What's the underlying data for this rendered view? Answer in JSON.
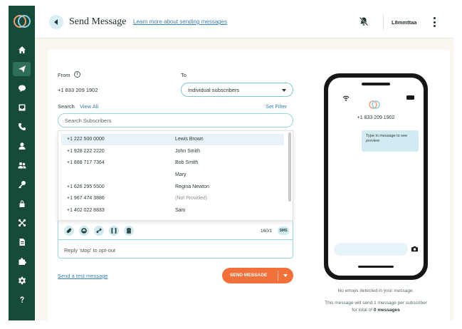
{
  "sidebar": {
    "logo": "logo",
    "items": [
      {
        "icon": "home-icon",
        "active": false
      },
      {
        "icon": "send-icon",
        "active": true
      },
      {
        "icon": "chat-icon",
        "active": false
      },
      {
        "icon": "inbox-icon",
        "active": false
      },
      {
        "icon": "phone-icon",
        "active": false
      },
      {
        "icon": "user-icon",
        "active": false
      },
      {
        "icon": "users-icon",
        "active": false
      },
      {
        "icon": "key-icon",
        "active": false
      },
      {
        "icon": "lock-icon",
        "active": false
      },
      {
        "icon": "integrations-icon",
        "active": false
      },
      {
        "icon": "document-icon",
        "active": false
      },
      {
        "icon": "puzzle-icon",
        "active": false
      },
      {
        "icon": "settings-icon",
        "active": false
      },
      {
        "icon": "help-icon",
        "active": false
      }
    ]
  },
  "header": {
    "title": "Send Message",
    "learn_link": "Learn more about sending messages",
    "user_name": "L8mmttaa"
  },
  "form": {
    "from_label": "From",
    "from_value": "+1 833 209 1902",
    "to_label": "To",
    "to_value": "Individual subscribers",
    "search_label": "Search",
    "view_all": "View All",
    "set_filter": "Set Filter",
    "search_placeholder": "Search Subscribers",
    "subscribers": [
      {
        "phone": "+1 222 500 0000",
        "name": "Lewis Brown"
      },
      {
        "phone": "+1 928 222 2220",
        "name": "John Smith"
      },
      {
        "phone": "+1 888 717 7364",
        "name": "Bob Smith"
      },
      {
        "phone": "",
        "name": "Mary"
      },
      {
        "phone": "+1 626 295 5500",
        "name": "Regina Newton"
      },
      {
        "phone": "+1 967 474 3886",
        "name": "(Not Provided)"
      },
      {
        "phone": "+1 402 022 8833",
        "name": "Sam"
      }
    ],
    "char_count": "160/1",
    "sms_badge": "SMS",
    "optout_text": "Reply 'stop' to opt-out",
    "test_link": "Send a test message",
    "send_button": "SEND MESSAGE"
  },
  "preview": {
    "number": "+1 833 209 1902",
    "bubble_text": "Type in message to see preview",
    "emoji_note": "No emojis detected in your message.",
    "summary_prefix": "This message will send 1 message per subscriber for total of",
    "summary_bold": "0 messages"
  },
  "colors": {
    "sidebar": "#164a3a",
    "accent": "#f2703a",
    "link": "#3b7fb1",
    "input_border": "#9ad2e0"
  }
}
